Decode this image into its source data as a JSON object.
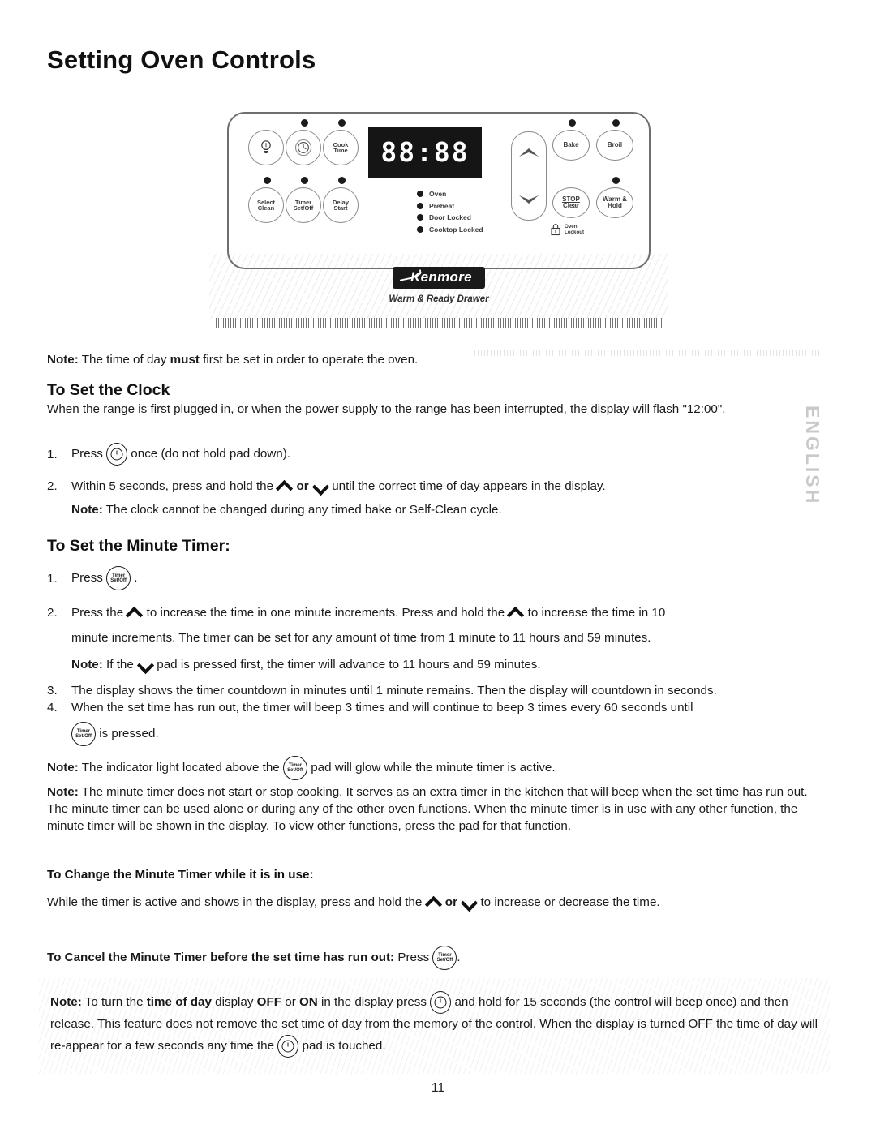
{
  "page": {
    "title": "Setting Oven Controls",
    "number": "11",
    "side_tab": "ENGLISH"
  },
  "control_panel": {
    "display_value": "88:88",
    "buttons_top": [
      {
        "name": "oven-light",
        "icon": "lightbulb-icon",
        "line1": "",
        "line2": ""
      },
      {
        "name": "clock",
        "icon": "clock-icon",
        "line1": "",
        "line2": ""
      },
      {
        "name": "cook-time",
        "icon": "",
        "line1": "Cook",
        "line2": "Time"
      }
    ],
    "buttons_bottom": [
      {
        "name": "self-clean",
        "line1": "Select",
        "line2": "Clean"
      },
      {
        "name": "timer-set-off",
        "line1": "Timer",
        "line2": "Set/Off"
      },
      {
        "name": "delay-start",
        "line1": "Delay",
        "line2": "Start"
      }
    ],
    "buttons_right_top": [
      {
        "name": "bake",
        "label": "Bake"
      },
      {
        "name": "broil",
        "label": "Broil"
      }
    ],
    "buttons_right_bottom": [
      {
        "name": "stop-clear",
        "line1": "STOP",
        "line2": "Clear"
      },
      {
        "name": "warm-hold",
        "line1": "Warm &",
        "line2": "Hold"
      }
    ],
    "oven_lockout_label_line1": "Oven",
    "oven_lockout_label_line2": "Lockout",
    "indicators": [
      "Oven",
      "Preheat",
      "Door Locked",
      "Cooktop Locked"
    ],
    "brand_logo": "Kenmore",
    "drawer_label": "Warm & Ready Drawer"
  },
  "content": {
    "note_top_label": "Note:",
    "note_top_a": " The time of day ",
    "note_top_bold": "must",
    "note_top_b": " first be set in order to operate the oven.",
    "clock_heading": "To Set the Clock",
    "clock_intro": "When the range is first plugged in, or when the power supply to the range has been interrupted, the display will flash \"12:00\".",
    "clock_step1_num": "1.",
    "clock_step1_pre": "Press",
    "clock_step1_post": "once (do not hold pad down).",
    "clock_step2_num": "2.",
    "clock_step2_a": "Within 5 seconds, press and hold the",
    "clock_step2_or": "or",
    "clock_step2_b": "until the correct time of day appears in the display.",
    "clock_step2_note_label": "Note:",
    "clock_step2_note": " The clock cannot be changed during any timed bake or Self-Clean cycle.",
    "timer_heading": "To Set the Minute Timer:",
    "timer_step1_num": "1.",
    "timer_step1_pre": "Press",
    "timer_step1_post": ".",
    "timer_step2_num": "2.",
    "timer_step2_a": "Press the",
    "timer_step2_b": "to increase the time in one minute increments. Press and hold the",
    "timer_step2_c": "to increase the time in 10",
    "timer_step2_cont": "minute increments. The timer can be set for any amount of time from 1 minute to 11 hours and 59 minutes.",
    "timer_step2_note_label": "Note:",
    "timer_step2_note_a": " If the",
    "timer_step2_note_b": "pad is pressed first, the timer will advance to 11 hours and 59 minutes.",
    "timer_step3_num": "3.",
    "timer_step3": "The display shows the timer countdown in minutes until 1 minute remains. Then the display will countdown in seconds.",
    "timer_step4_num": "4.",
    "timer_step4": "When the set time has run out, the timer will beep 3 times and will continue to beep 3 times every 60 seconds until",
    "timer_step4_tail": "is pressed.",
    "note_indicator_label": "Note:",
    "note_indicator_a": " The indicator light located above the",
    "note_indicator_b": "pad will glow while the minute timer is active.",
    "note_long_label": "Note:",
    "note_long": " The minute timer does not start or stop cooking. It serves as an extra timer in the kitchen that will beep when the set time has run out. The minute timer can be used alone or during any of the other oven functions. When the minute timer is in use with any other function, the minute timer will be shown in the display. To view other functions, press the pad for that function.",
    "change_heading": "To Change the Minute Timer while it is in use:",
    "change_a": "While the timer is active and shows in the display, press and hold the",
    "change_or": "or",
    "change_b": "to increase or decrease the time.",
    "cancel_heading": "To Cancel the Minute Timer before the set time has run out:",
    "cancel_press": "Press",
    "cancel_post": ".",
    "note_bottom_label": "Note:",
    "note_bottom_a": " To turn the ",
    "note_bottom_bold1": "time of day",
    "note_bottom_b": " display ",
    "note_bottom_bold2": "OFF",
    "note_bottom_c": " or ",
    "note_bottom_bold3": "ON",
    "note_bottom_d": " in the display press",
    "note_bottom_e": "and hold for 15 seconds (the control will beep once) and then release. This feature does not remove the set time of day from the memory of the control. When the display is turned OFF the time of day will re-appear for a few seconds any time the",
    "note_bottom_f": "pad is touched."
  },
  "pad_glyphs": {
    "timer_line1": "Timer",
    "timer_line2": "Set/Off"
  }
}
